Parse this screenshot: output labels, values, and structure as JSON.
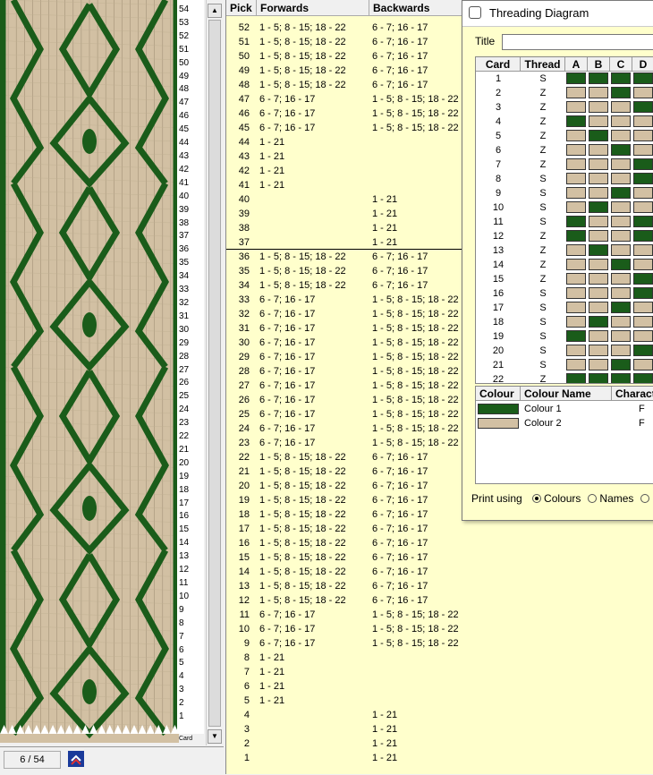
{
  "colors": {
    "colour1": "#1a5c1a",
    "colour2": "#d2c0a3",
    "picklist_bg": "#ffffcc"
  },
  "pick_labels": [
    "54",
    "53",
    "52",
    "51",
    "50",
    "49",
    "48",
    "47",
    "46",
    "45",
    "44",
    "43",
    "42",
    "41",
    "40",
    "39",
    "38",
    "37",
    "36",
    "35",
    "34",
    "33",
    "32",
    "31",
    "30",
    "29",
    "28",
    "27",
    "26",
    "25",
    "24",
    "23",
    "22",
    "21",
    "20",
    "19",
    "18",
    "17",
    "16",
    "15",
    "14",
    "13",
    "12",
    "11",
    "10",
    "9",
    "8",
    "7",
    "6",
    "5",
    "4",
    "3",
    "2",
    "1"
  ],
  "card_axis_label": "Card",
  "status": {
    "pick": "6 / 54"
  },
  "picklist": {
    "headers": {
      "pick": "Pick",
      "forwards": "Forwards",
      "backwards": "Backwards"
    },
    "rows": [
      {
        "pick": "52",
        "fw": "1 - 5; 8 - 15; 18 - 22",
        "bw": "6 - 7; 16 - 17"
      },
      {
        "pick": "51",
        "fw": "1 - 5; 8 - 15; 18 - 22",
        "bw": "6 - 7; 16 - 17"
      },
      {
        "pick": "50",
        "fw": "1 - 5; 8 - 15; 18 - 22",
        "bw": "6 - 7; 16 - 17"
      },
      {
        "pick": "49",
        "fw": "1 - 5; 8 - 15; 18 - 22",
        "bw": "6 - 7; 16 - 17"
      },
      {
        "pick": "48",
        "fw": "1 - 5; 8 - 15; 18 - 22",
        "bw": "6 - 7; 16 - 17"
      },
      {
        "pick": "47",
        "fw": "6 - 7; 16 - 17",
        "bw": "1 - 5; 8 - 15; 18 - 22"
      },
      {
        "pick": "46",
        "fw": "6 - 7; 16 - 17",
        "bw": "1 - 5; 8 - 15; 18 - 22"
      },
      {
        "pick": "45",
        "fw": "6 - 7; 16 - 17",
        "bw": "1 - 5; 8 - 15; 18 - 22"
      },
      {
        "pick": "44",
        "fw": "1 - 21",
        "bw": ""
      },
      {
        "pick": "43",
        "fw": "1 - 21",
        "bw": ""
      },
      {
        "pick": "42",
        "fw": "1 - 21",
        "bw": ""
      },
      {
        "pick": "41",
        "fw": "1 - 21",
        "bw": ""
      },
      {
        "pick": "40",
        "fw": "",
        "bw": "1 - 21"
      },
      {
        "pick": "39",
        "fw": "",
        "bw": "1 - 21"
      },
      {
        "pick": "38",
        "fw": "",
        "bw": "1 - 21"
      },
      {
        "pick": "37",
        "fw": "",
        "bw": "1 - 21"
      },
      {
        "pick": "36",
        "fw": "1 - 5; 8 - 15; 18 - 22",
        "bw": "6 - 7; 16 - 17"
      },
      {
        "pick": "35",
        "fw": "1 - 5; 8 - 15; 18 - 22",
        "bw": "6 - 7; 16 - 17"
      },
      {
        "pick": "34",
        "fw": "1 - 5; 8 - 15; 18 - 22",
        "bw": "6 - 7; 16 - 17"
      },
      {
        "pick": "33",
        "fw": "6 - 7; 16 - 17",
        "bw": "1 - 5; 8 - 15; 18 - 22"
      },
      {
        "pick": "32",
        "fw": "6 - 7; 16 - 17",
        "bw": "1 - 5; 8 - 15; 18 - 22"
      },
      {
        "pick": "31",
        "fw": "6 - 7; 16 - 17",
        "bw": "1 - 5; 8 - 15; 18 - 22"
      },
      {
        "pick": "30",
        "fw": "6 - 7; 16 - 17",
        "bw": "1 - 5; 8 - 15; 18 - 22"
      },
      {
        "pick": "29",
        "fw": "6 - 7; 16 - 17",
        "bw": "1 - 5; 8 - 15; 18 - 22"
      },
      {
        "pick": "28",
        "fw": "6 - 7; 16 - 17",
        "bw": "1 - 5; 8 - 15; 18 - 22"
      },
      {
        "pick": "27",
        "fw": "6 - 7; 16 - 17",
        "bw": "1 - 5; 8 - 15; 18 - 22"
      },
      {
        "pick": "26",
        "fw": "6 - 7; 16 - 17",
        "bw": "1 - 5; 8 - 15; 18 - 22"
      },
      {
        "pick": "25",
        "fw": "6 - 7; 16 - 17",
        "bw": "1 - 5; 8 - 15; 18 - 22"
      },
      {
        "pick": "24",
        "fw": "6 - 7; 16 - 17",
        "bw": "1 - 5; 8 - 15; 18 - 22"
      },
      {
        "pick": "23",
        "fw": "6 - 7; 16 - 17",
        "bw": "1 - 5; 8 - 15; 18 - 22"
      },
      {
        "pick": "22",
        "fw": "1 - 5; 8 - 15; 18 - 22",
        "bw": "6 - 7; 16 - 17"
      },
      {
        "pick": "21",
        "fw": "1 - 5; 8 - 15; 18 - 22",
        "bw": "6 - 7; 16 - 17"
      },
      {
        "pick": "20",
        "fw": "1 - 5; 8 - 15; 18 - 22",
        "bw": "6 - 7; 16 - 17"
      },
      {
        "pick": "19",
        "fw": "1 - 5; 8 - 15; 18 - 22",
        "bw": "6 - 7; 16 - 17"
      },
      {
        "pick": "18",
        "fw": "1 - 5; 8 - 15; 18 - 22",
        "bw": "6 - 7; 16 - 17"
      },
      {
        "pick": "17",
        "fw": "1 - 5; 8 - 15; 18 - 22",
        "bw": "6 - 7; 16 - 17"
      },
      {
        "pick": "16",
        "fw": "1 - 5; 8 - 15; 18 - 22",
        "bw": "6 - 7; 16 - 17"
      },
      {
        "pick": "15",
        "fw": "1 - 5; 8 - 15; 18 - 22",
        "bw": "6 - 7; 16 - 17"
      },
      {
        "pick": "14",
        "fw": "1 - 5; 8 - 15; 18 - 22",
        "bw": "6 - 7; 16 - 17"
      },
      {
        "pick": "13",
        "fw": "1 - 5; 8 - 15; 18 - 22",
        "bw": "6 - 7; 16 - 17"
      },
      {
        "pick": "12",
        "fw": "1 - 5; 8 - 15; 18 - 22",
        "bw": "6 - 7; 16 - 17"
      },
      {
        "pick": "11",
        "fw": "6 - 7; 16 - 17",
        "bw": "1 - 5; 8 - 15; 18 - 22"
      },
      {
        "pick": "10",
        "fw": "6 - 7; 16 - 17",
        "bw": "1 - 5; 8 - 15; 18 - 22"
      },
      {
        "pick": "9",
        "fw": "6 - 7; 16 - 17",
        "bw": "1 - 5; 8 - 15; 18 - 22"
      },
      {
        "pick": "8",
        "fw": "1 - 21",
        "bw": ""
      },
      {
        "pick": "7",
        "fw": "1 - 21",
        "bw": ""
      },
      {
        "pick": "6",
        "fw": "1 - 21",
        "bw": ""
      },
      {
        "pick": "5",
        "fw": "1 - 21",
        "bw": ""
      },
      {
        "pick": "4",
        "fw": "",
        "bw": "1 - 21"
      },
      {
        "pick": "3",
        "fw": "",
        "bw": "1 - 21"
      },
      {
        "pick": "2",
        "fw": "",
        "bw": "1 - 21"
      },
      {
        "pick": "1",
        "fw": "",
        "bw": "1 - 21"
      }
    ]
  },
  "dialog": {
    "title": "Threading Diagram",
    "title_label": "Title",
    "title_value": "",
    "card_headers": [
      "Card",
      "Thread",
      "A",
      "B",
      "C",
      "D"
    ],
    "cards": [
      {
        "card": "1",
        "thread": "S",
        "holes": [
          1,
          1,
          1,
          1
        ]
      },
      {
        "card": "2",
        "thread": "Z",
        "holes": [
          2,
          2,
          1,
          2
        ]
      },
      {
        "card": "3",
        "thread": "Z",
        "holes": [
          2,
          2,
          2,
          1
        ]
      },
      {
        "card": "4",
        "thread": "Z",
        "holes": [
          1,
          2,
          2,
          2
        ]
      },
      {
        "card": "5",
        "thread": "Z",
        "holes": [
          2,
          1,
          2,
          2
        ]
      },
      {
        "card": "6",
        "thread": "Z",
        "holes": [
          2,
          2,
          1,
          2
        ]
      },
      {
        "card": "7",
        "thread": "Z",
        "holes": [
          2,
          2,
          2,
          1
        ]
      },
      {
        "card": "8",
        "thread": "S",
        "holes": [
          2,
          2,
          2,
          1
        ]
      },
      {
        "card": "9",
        "thread": "S",
        "holes": [
          2,
          2,
          1,
          2
        ]
      },
      {
        "card": "10",
        "thread": "S",
        "holes": [
          2,
          1,
          2,
          2
        ]
      },
      {
        "card": "11",
        "thread": "S",
        "holes": [
          1,
          2,
          2,
          1
        ]
      },
      {
        "card": "12",
        "thread": "Z",
        "holes": [
          1,
          2,
          2,
          1
        ]
      },
      {
        "card": "13",
        "thread": "Z",
        "holes": [
          2,
          1,
          2,
          2
        ]
      },
      {
        "card": "14",
        "thread": "Z",
        "holes": [
          2,
          2,
          1,
          2
        ]
      },
      {
        "card": "15",
        "thread": "Z",
        "holes": [
          2,
          2,
          2,
          1
        ]
      },
      {
        "card": "16",
        "thread": "S",
        "holes": [
          2,
          2,
          2,
          1
        ]
      },
      {
        "card": "17",
        "thread": "S",
        "holes": [
          2,
          2,
          1,
          2
        ]
      },
      {
        "card": "18",
        "thread": "S",
        "holes": [
          2,
          1,
          2,
          2
        ]
      },
      {
        "card": "19",
        "thread": "S",
        "holes": [
          1,
          2,
          2,
          2
        ]
      },
      {
        "card": "20",
        "thread": "S",
        "holes": [
          2,
          2,
          2,
          1
        ]
      },
      {
        "card": "21",
        "thread": "S",
        "holes": [
          2,
          2,
          1,
          2
        ]
      },
      {
        "card": "22",
        "thread": "Z",
        "holes": [
          1,
          1,
          1,
          1
        ]
      }
    ],
    "colour_headers": [
      "Colour",
      "Colour Name",
      "Charact"
    ],
    "colours": [
      {
        "name": "Colour 1",
        "char": "F",
        "color": "#1a5c1a"
      },
      {
        "name": "Colour 2",
        "char": "F",
        "color": "#d2c0a3"
      }
    ],
    "print_using_label": "Print using",
    "print_options": [
      {
        "label": "Colours",
        "selected": true
      },
      {
        "label": "Names",
        "selected": false
      },
      {
        "label": "",
        "selected": false
      }
    ]
  }
}
